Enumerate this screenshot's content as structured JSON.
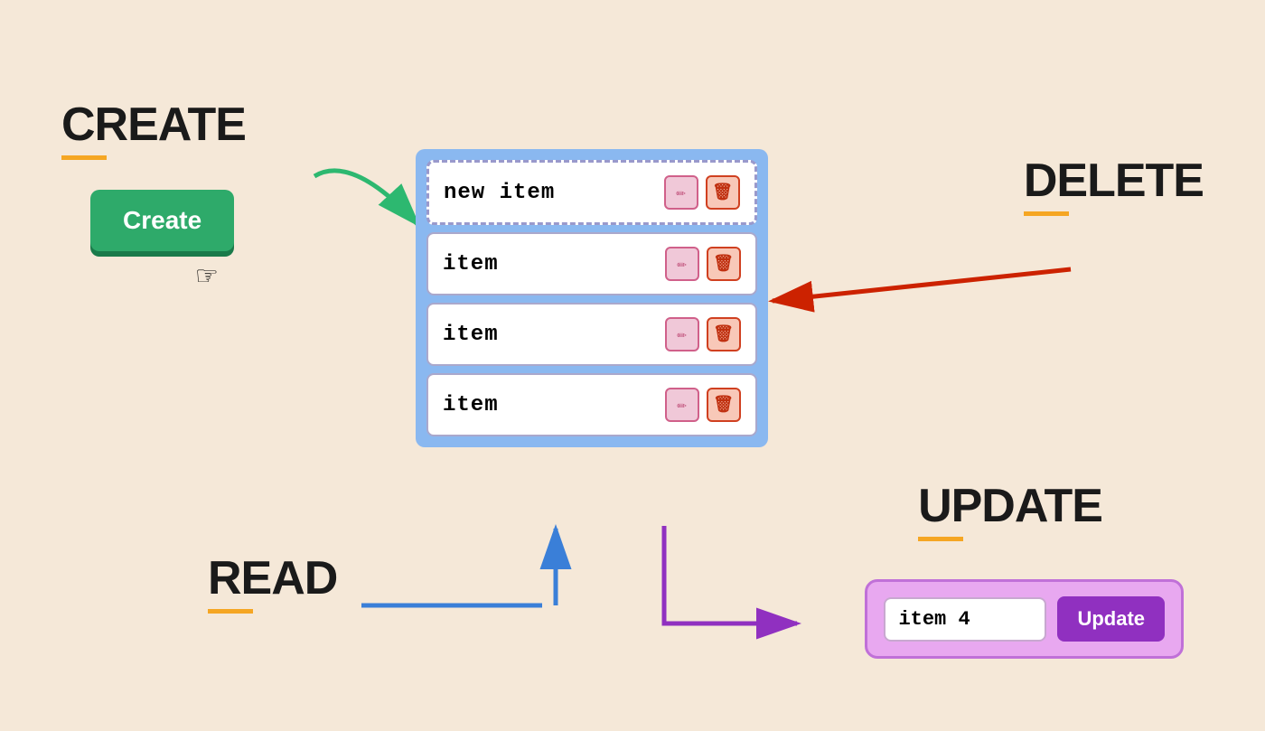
{
  "page": {
    "bg": "#f5e8d8"
  },
  "labels": {
    "create": "CREATE",
    "delete": "DELETE",
    "read": "READ",
    "update": "UPDATE"
  },
  "create_button": {
    "label": "Create"
  },
  "list": {
    "new_item_label": "new item",
    "items": [
      {
        "label": "item"
      },
      {
        "label": "item"
      },
      {
        "label": "item"
      }
    ]
  },
  "update": {
    "input_value": "item 4",
    "button_label": "Update"
  },
  "icons": {
    "edit": "✏",
    "trash": "🗑",
    "cursor": "☞"
  }
}
